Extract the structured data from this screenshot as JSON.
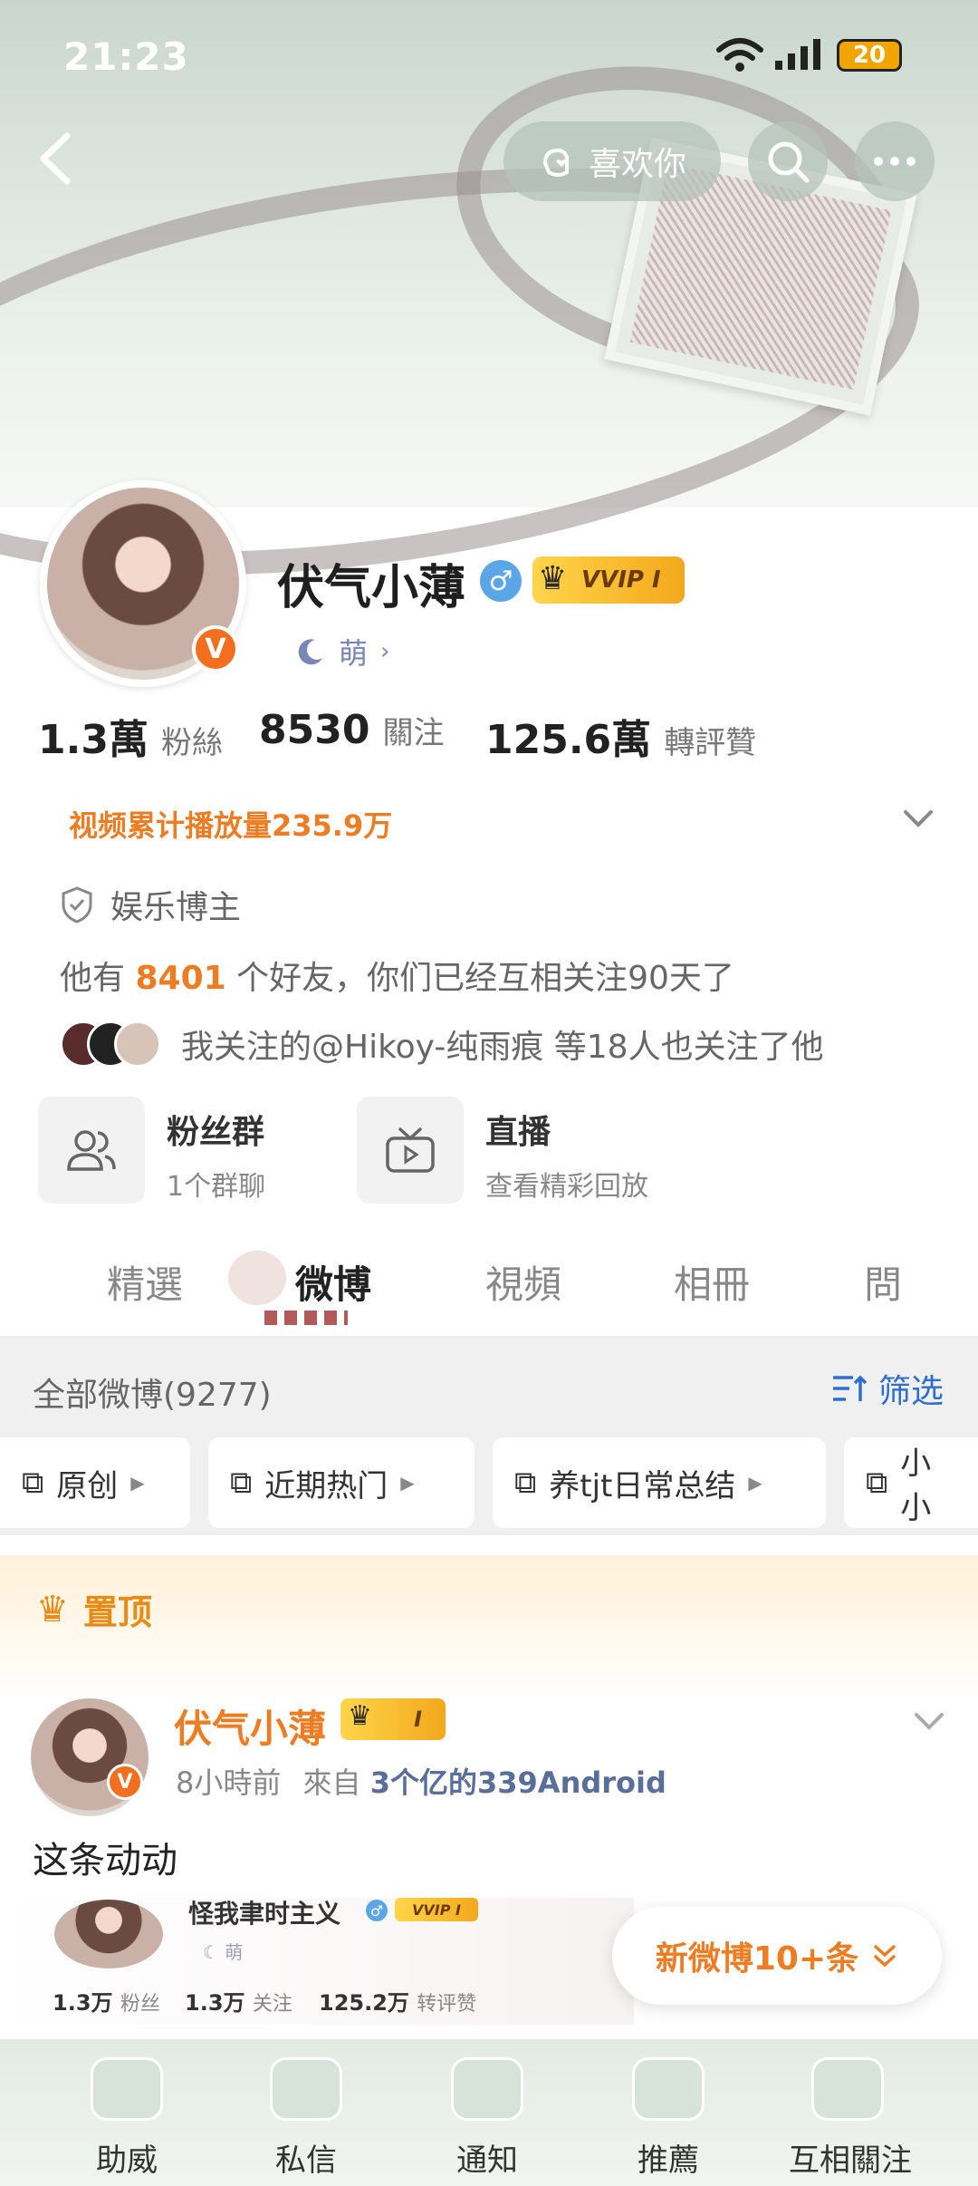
{
  "status_bar": {
    "time": "21:23",
    "battery": "20"
  },
  "header": {
    "like_label": "喜欢你"
  },
  "profile": {
    "name": "伏气小薄",
    "vip": "VVIP Ⅰ",
    "tag": "萌",
    "verified_badge": "V",
    "stats": [
      {
        "value": "1.3萬",
        "label": "粉絲"
      },
      {
        "value": "8530",
        "label": "關注"
      },
      {
        "value": "125.6萬",
        "label": "轉評贊"
      }
    ],
    "play_count": "视频累计播放量235.9万",
    "category": "娱乐博主",
    "friends_prefix": "他有",
    "friends_count": "8401",
    "friends_suffix": "个好友，你们已经互相关注90天了",
    "mutual_follow": "我关注的@Hikoy-纯雨痕 等18人也关注了他"
  },
  "cards": [
    {
      "title": "粉丝群",
      "subtitle": "1个群聊"
    },
    {
      "title": "直播",
      "subtitle": "查看精彩回放"
    }
  ],
  "tabs": [
    "精選",
    "微博",
    "視頻",
    "相冊",
    "問"
  ],
  "filter": {
    "all_label": "全部微博(9277)",
    "filter_label": "筛选",
    "chips": [
      "原创",
      "近期热门",
      "养tjt日常总结",
      "小小"
    ]
  },
  "pinned_label": "置顶",
  "post": {
    "author": "伏气小薄",
    "vip": "Ⅰ",
    "time": "8小時前",
    "from_prefix": "來自",
    "source": "3个亿的339Android",
    "text": "这条动动",
    "embed": {
      "name": "怪我聿时主义",
      "vip": "VVIP Ⅰ",
      "tag": "萌",
      "stats": [
        {
          "value": "1.3万",
          "label": "粉丝"
        },
        {
          "value": "1.3万",
          "label": "关注"
        },
        {
          "value": "125.2万",
          "label": "转评赞"
        }
      ]
    }
  },
  "new_posts": "新微博10+条",
  "bottom_nav": [
    "助威",
    "私信",
    "通知",
    "推薦",
    "互相關注"
  ],
  "colors": {
    "accent": "#ee7c22",
    "link": "#2d6fd0",
    "vip_gold": "#f3a81c"
  }
}
